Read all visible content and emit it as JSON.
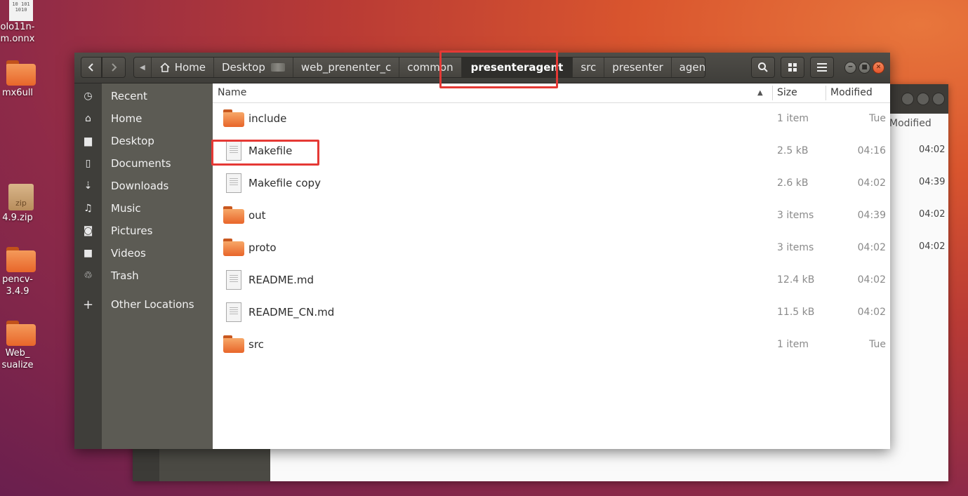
{
  "desktop": {
    "icons": [
      {
        "label1": "olo11n-",
        "label2": "m.onnx",
        "kind": "binary",
        "bin_text": "10 101 1010"
      },
      {
        "label1": "mx6ull",
        "label2": "",
        "kind": "folder"
      },
      {
        "label1": "4.9.zip",
        "label2": "",
        "kind": "zip",
        "badge": "zip"
      },
      {
        "label1": "pencv-",
        "label2": "3.4.9",
        "kind": "folder"
      },
      {
        "label1": "Web_",
        "label2": "sualize",
        "kind": "folder"
      }
    ]
  },
  "background_window": {
    "modified_header": "Modified",
    "times": [
      "04:02",
      "04:39",
      "04:02",
      "04:02"
    ]
  },
  "header": {
    "back_icon": "chevron-left-icon",
    "forward_icon": "chevron-right-icon",
    "breadcrumbs": [
      "Home",
      "Desktop",
      "web_prenenter_c",
      "common",
      "presenteragent",
      "src",
      "presenter",
      "agent"
    ],
    "active_crumb": "presenteragent",
    "search_icon": "search-icon",
    "grid_icon": "grid-view-icon",
    "menu_icon": "hamburger-menu-icon"
  },
  "sidebar": {
    "items": [
      {
        "label": "Recent",
        "icon": "clock-icon"
      },
      {
        "label": "Home",
        "icon": "home-icon"
      },
      {
        "label": "Desktop",
        "icon": "folder-icon"
      },
      {
        "label": "Documents",
        "icon": "document-icon"
      },
      {
        "label": "Downloads",
        "icon": "download-icon"
      },
      {
        "label": "Music",
        "icon": "music-icon"
      },
      {
        "label": "Pictures",
        "icon": "camera-icon"
      },
      {
        "label": "Videos",
        "icon": "video-icon"
      },
      {
        "label": "Trash",
        "icon": "trash-icon"
      },
      {
        "label": "Other Locations",
        "icon": "plus-icon"
      }
    ]
  },
  "columns": {
    "name": "Name",
    "size": "Size",
    "modified": "Modified",
    "sort": "ascending"
  },
  "files": [
    {
      "name": "include",
      "type": "folder",
      "size": "1 item",
      "modified": "Tue"
    },
    {
      "name": "Makefile",
      "type": "file",
      "size": "2.5 kB",
      "modified": "04:16"
    },
    {
      "name": "Makefile copy",
      "type": "file",
      "size": "2.6 kB",
      "modified": "04:02"
    },
    {
      "name": "out",
      "type": "folder",
      "size": "3 items",
      "modified": "04:39"
    },
    {
      "name": "proto",
      "type": "folder",
      "size": "3 items",
      "modified": "04:02"
    },
    {
      "name": "README.md",
      "type": "file",
      "size": "12.4 kB",
      "modified": "04:02"
    },
    {
      "name": "README_CN.md",
      "type": "file",
      "size": "11.5 kB",
      "modified": "04:02"
    },
    {
      "name": "src",
      "type": "folder",
      "size": "1 item",
      "modified": "Tue"
    }
  ],
  "colors": {
    "highlight": "#e53935",
    "folder": "#e8662a"
  }
}
